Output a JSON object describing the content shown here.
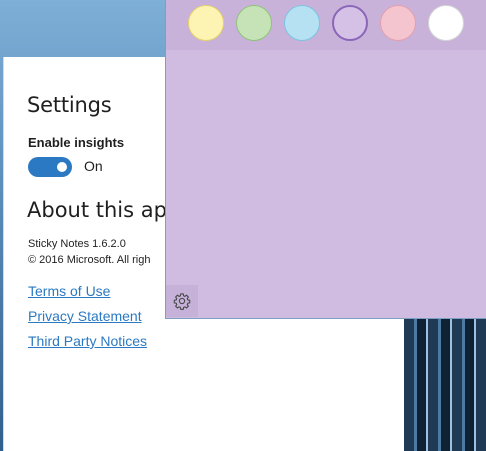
{
  "settings": {
    "title": "Settings",
    "insights_label": "Enable insights",
    "toggle_state": "On",
    "about_title": "About this ap",
    "app_version": "Sticky Notes  1.6.2.0",
    "copyright": "© 2016 Microsoft. All righ",
    "links": {
      "terms": "Terms of Use",
      "privacy": "Privacy Statement",
      "third_party": "Third Party Notices"
    }
  },
  "sticky_note": {
    "background_color": "#d0bce0",
    "swatches": [
      {
        "name": "yellow",
        "color": "#fdf4b4",
        "border": "#e6d26a",
        "selected": false
      },
      {
        "name": "green",
        "color": "#c5e3b7",
        "border": "#8fc27a",
        "selected": false
      },
      {
        "name": "blue",
        "color": "#b6e1f2",
        "border": "#7cc3e0",
        "selected": false
      },
      {
        "name": "purple",
        "color": "#d5c1e5",
        "border": "#8a66b8",
        "selected": true
      },
      {
        "name": "pink",
        "color": "#f4c4cf",
        "border": "#e3a0ad",
        "selected": false
      },
      {
        "name": "white",
        "color": "#ffffff",
        "border": "#d5d5d5",
        "selected": false
      }
    ],
    "settings_icon": "gear-icon"
  },
  "colors": {
    "accent": "#2b79c2",
    "text": "#1f1f1f"
  }
}
